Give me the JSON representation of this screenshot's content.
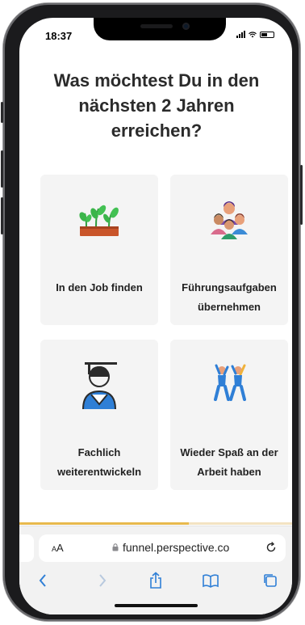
{
  "status_bar": {
    "time": "18:37"
  },
  "page": {
    "question": "Was möchtest Du in den nächsten 2 Jahren erreichen?"
  },
  "options": [
    {
      "label": "In den Job finden",
      "icon": "sprouting-plant-icon"
    },
    {
      "label": "Führungsaufgaben übernehmen",
      "icon": "team-people-icon"
    },
    {
      "label": "Fachlich weiterentwickeln",
      "icon": "graduate-icon"
    },
    {
      "label": "Wieder Spaß an der Arbeit haben",
      "icon": "happy-people-icon"
    }
  ],
  "progress": {
    "fraction": 0.62,
    "color": "#e8b94d"
  },
  "browser": {
    "text_size_label": "AA",
    "url": "funnel.perspective.co"
  },
  "colors": {
    "accent_blue": "#2f7fd6",
    "card_background": "#f4f4f4",
    "heading_text": "#2b2b2b"
  }
}
